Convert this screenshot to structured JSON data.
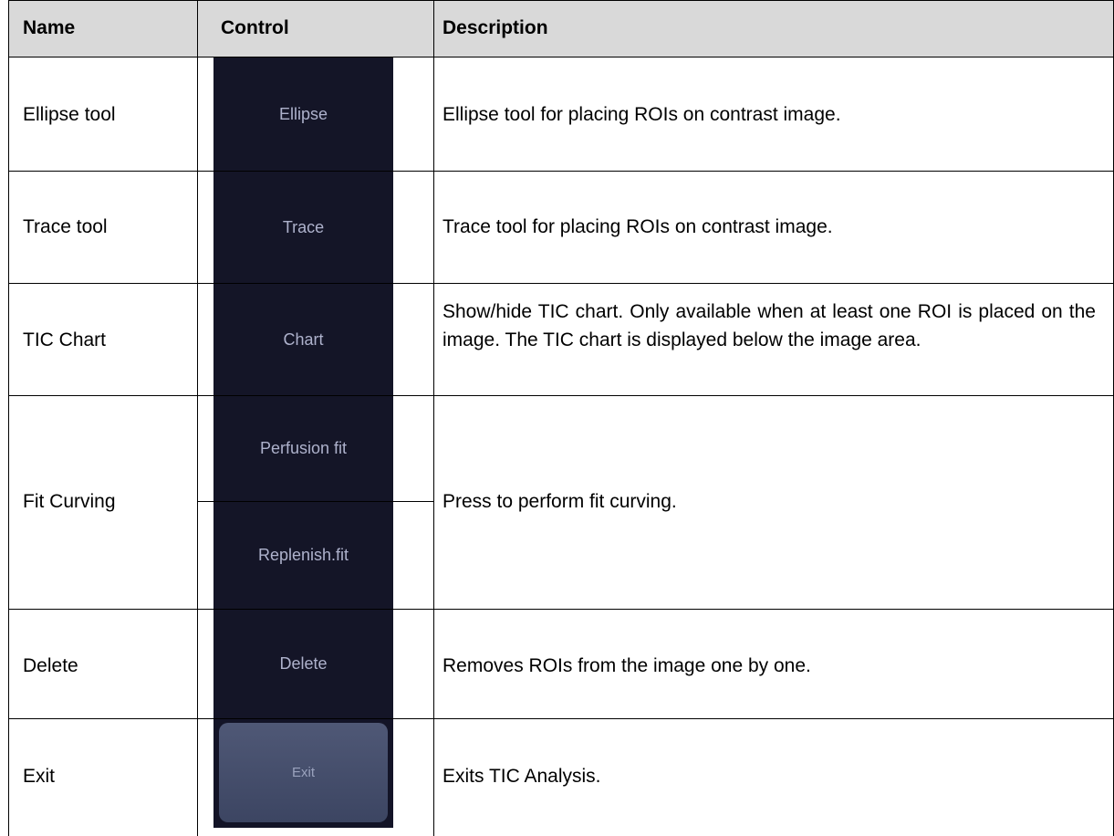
{
  "header": {
    "name": "Name",
    "control": "Control",
    "description": "Description"
  },
  "rows": [
    {
      "name": "Ellipse tool",
      "controls": [
        "Ellipse"
      ],
      "description": "Ellipse tool for placing ROIs on contrast image."
    },
    {
      "name": "Trace tool",
      "controls": [
        "Trace"
      ],
      "description": "Trace tool for placing ROIs on contrast image."
    },
    {
      "name": "TIC Chart",
      "controls": [
        "Chart"
      ],
      "description": "Show/hide TIC chart. Only available when at least one ROI is placed on the image. The TIC chart is displayed below the image area."
    },
    {
      "name": "Fit Curving",
      "controls": [
        "Perfusion fit",
        "Replenish.fit"
      ],
      "description": "Press to perform fit curving."
    },
    {
      "name": "Delete",
      "controls": [
        "Delete"
      ],
      "description": "Removes ROIs from the image one by one."
    },
    {
      "name": "Exit",
      "controls": [
        "Exit"
      ],
      "description": "Exits TIC Analysis."
    }
  ]
}
